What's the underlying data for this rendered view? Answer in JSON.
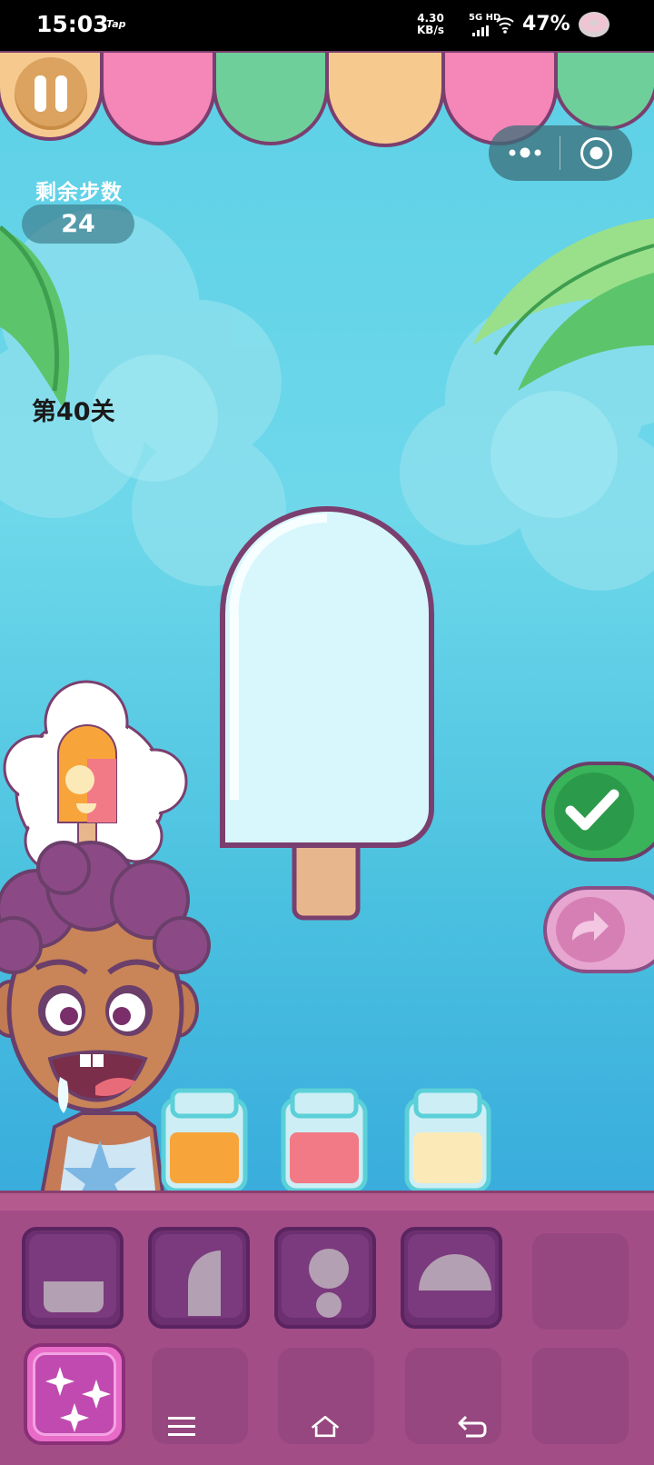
{
  "status_bar": {
    "time": "15:03",
    "app_badge": "Tap",
    "net_speed_value": "4.30",
    "net_speed_unit": "KB/s",
    "network_type": "5G HD",
    "battery": "47%"
  },
  "hud": {
    "steps_label": "剩余步数",
    "steps_value": "24",
    "level_label": "第40关"
  },
  "colors": {
    "awning": [
      "#f6c98f",
      "#f486b8",
      "#6fcf9a",
      "#f6c98f",
      "#f486b8",
      "#6fcf9a"
    ],
    "jars": [
      "#f7a53b",
      "#f27a86",
      "#fbeab8"
    ],
    "confirm": "#3ab45b",
    "redo": "#e7a6cf",
    "tray": "#a34d87"
  },
  "icons": {
    "pause": "pause-icon",
    "more": "more-dots-icon",
    "close_target": "target-icon",
    "confirm": "checkmark-icon",
    "redo": "redo-arrow-icon",
    "magic": "sparkles-icon",
    "nav_menu": "menu-icon",
    "nav_home": "home-icon",
    "nav_back": "back-icon"
  },
  "shape_tray": {
    "row1": [
      "bowl-shape",
      "half-oval-shape",
      "double-circle-shape",
      "dome-shape",
      "empty"
    ],
    "row2": [
      "magic",
      "empty",
      "empty",
      "empty",
      "empty"
    ]
  }
}
